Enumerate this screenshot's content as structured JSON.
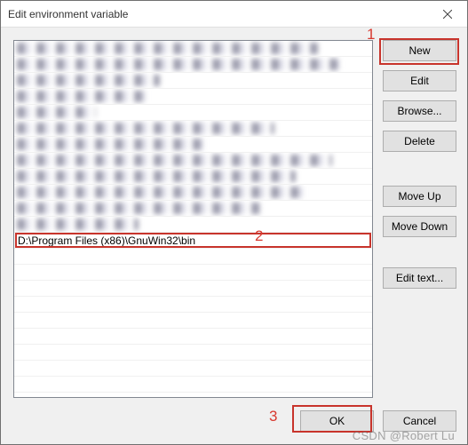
{
  "window": {
    "title": "Edit environment variable"
  },
  "list": {
    "obscured_count": 12,
    "selected_value": "D:\\Program Files (x86)\\GnuWin32\\bin"
  },
  "buttons": {
    "new": "New",
    "edit": "Edit",
    "browse": "Browse...",
    "delete": "Delete",
    "move_up": "Move Up",
    "move_down": "Move Down",
    "edit_text": "Edit text...",
    "ok": "OK",
    "cancel": "Cancel"
  },
  "annotations": {
    "n1": "1",
    "n2": "2",
    "n3": "3"
  },
  "watermark": "CSDN @Robert Lu"
}
